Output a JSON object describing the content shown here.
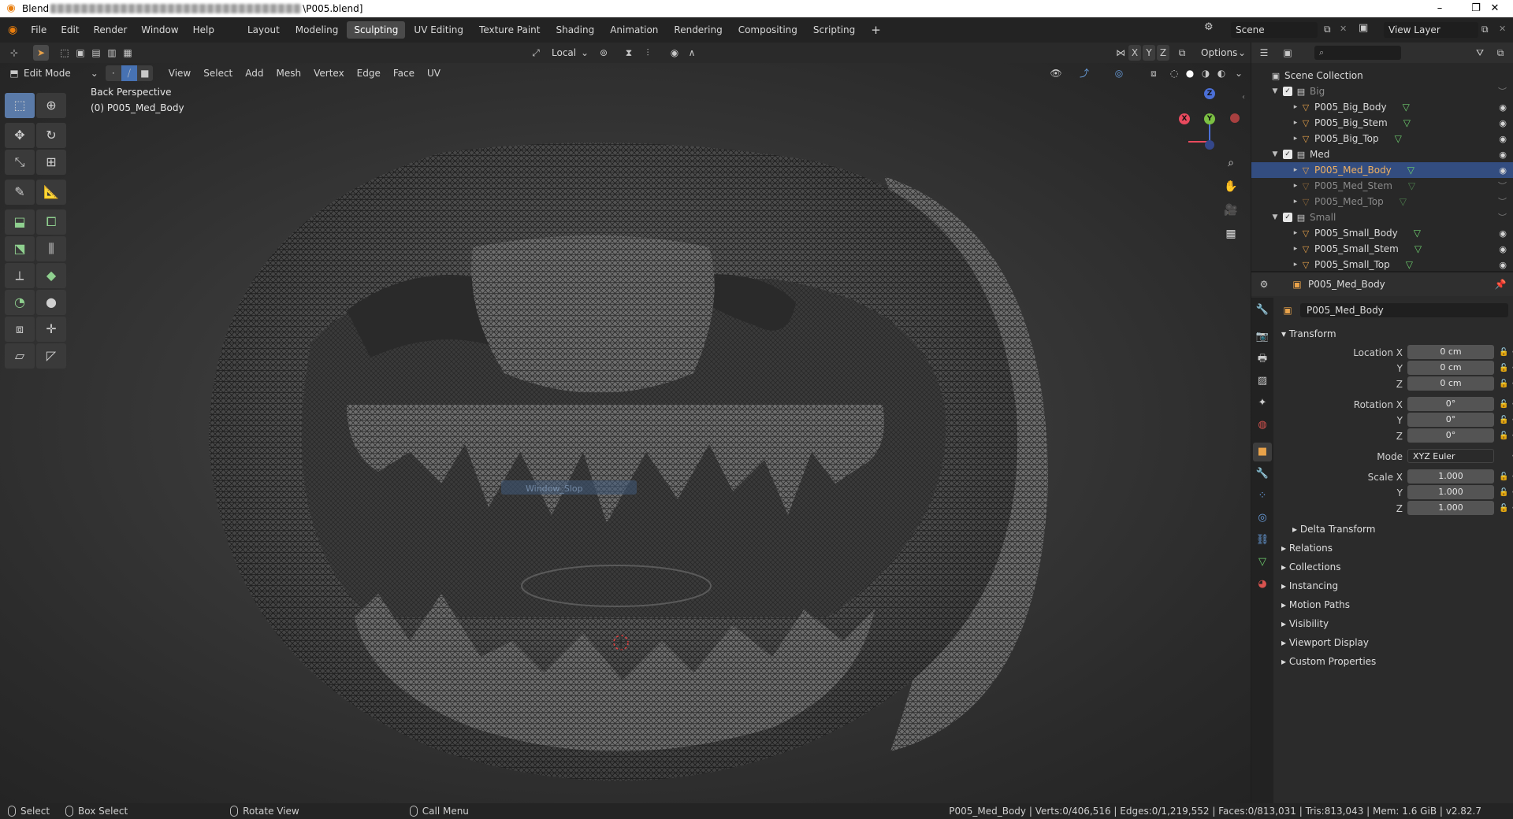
{
  "window": {
    "app_icon": "blender-logo-icon",
    "title": "Blend",
    "title_file": "\\P005.blend]",
    "minimize": "–",
    "restore": "❐",
    "close": "✕"
  },
  "topbar": {
    "menus": [
      "File",
      "Edit",
      "Render",
      "Window",
      "Help"
    ],
    "workspaces": [
      "Layout",
      "Modeling",
      "Sculpting",
      "UV Editing",
      "Texture Paint",
      "Shading",
      "Animation",
      "Rendering",
      "Compositing",
      "Scripting"
    ],
    "active_workspace": "Sculpting",
    "add_workspace": "+",
    "scene_label": "Scene",
    "view_layer_label": "View Layer"
  },
  "viewport": {
    "transform_orientation": "Local",
    "axis_labels": [
      "X",
      "Y",
      "Z"
    ],
    "options_label": "Options",
    "mode_label": "Edit Mode",
    "menus": [
      "View",
      "Select",
      "Add",
      "Mesh",
      "Vertex",
      "Edge",
      "Face",
      "UV"
    ],
    "view_name": "Back Perspective",
    "object_name": "(0) P005_Med_Body",
    "gizmo": {
      "x": "X",
      "y": "Y",
      "z": "Z"
    },
    "ghost_label": "Window_Slop"
  },
  "toolbar": {
    "tools": [
      "select-box",
      "cursor",
      "move",
      "rotate",
      "scale",
      "transform",
      "annotate",
      "measure",
      "extrude-region",
      "inset-faces",
      "bevel",
      "loop-cut",
      "knife",
      "poly-build",
      "spin",
      "smooth",
      "edge-slide",
      "shrink-fatten",
      "shear",
      "rip-region"
    ]
  },
  "outliner": {
    "root": "Scene Collection",
    "items": [
      {
        "label": "Big",
        "type": "collection",
        "level": 1,
        "dim": true,
        "checked": true
      },
      {
        "label": "P005_Big_Body",
        "type": "object",
        "level": 2
      },
      {
        "label": "P005_Big_Stem",
        "type": "object",
        "level": 2
      },
      {
        "label": "P005_Big_Top",
        "type": "object",
        "level": 2
      },
      {
        "label": "Med",
        "type": "collection",
        "level": 1,
        "dim": false,
        "checked": true
      },
      {
        "label": "P005_Med_Body",
        "type": "object",
        "level": 2,
        "selected": true
      },
      {
        "label": "P005_Med_Stem",
        "type": "object",
        "level": 2,
        "dim": true
      },
      {
        "label": "P005_Med_Top",
        "type": "object",
        "level": 2,
        "dim": true
      },
      {
        "label": "Small",
        "type": "collection",
        "level": 1,
        "dim": true,
        "checked": true
      },
      {
        "label": "P005_Small_Body",
        "type": "object",
        "level": 2
      },
      {
        "label": "P005_Small_Stem",
        "type": "object",
        "level": 2
      },
      {
        "label": "P005_Small_Top",
        "type": "object",
        "level": 2
      }
    ]
  },
  "properties": {
    "header_object": "P005_Med_Body",
    "object_name": "P005_Med_Body",
    "transform_label": "Transform",
    "location_label": "Location X",
    "location": [
      "0 cm",
      "0 cm",
      "0 cm"
    ],
    "rotation_label": "Rotation X",
    "rotation": [
      "0°",
      "0°",
      "0°"
    ],
    "mode_label": "Mode",
    "mode_value": "XYZ Euler",
    "scale_label": "Scale X",
    "scale": [
      "1.000",
      "1.000",
      "1.000"
    ],
    "axis_y": "Y",
    "axis_z": "Z",
    "delta_transform": "Delta Transform",
    "sections": [
      "Relations",
      "Collections",
      "Instancing",
      "Motion Paths",
      "Visibility",
      "Viewport Display",
      "Custom Properties"
    ]
  },
  "statusbar": {
    "select": "Select",
    "box_select": "Box Select",
    "rotate_view": "Rotate View",
    "call_menu": "Call Menu",
    "stats": "P005_Med_Body | Verts:0/406,516 | Edges:0/1,219,552 | Faces:0/813,031 | Tris:813,043 | Mem: 1.6 GiB | v2.82.7"
  },
  "colors": {
    "accent": "#4772b3",
    "selected_row": "#334d80",
    "axis_x": "#e94a5e",
    "axis_y": "#7bc043",
    "axis_z": "#4b6fd6",
    "mesh_icon": "#6fcf6f",
    "object_icon": "#e8a24a"
  }
}
